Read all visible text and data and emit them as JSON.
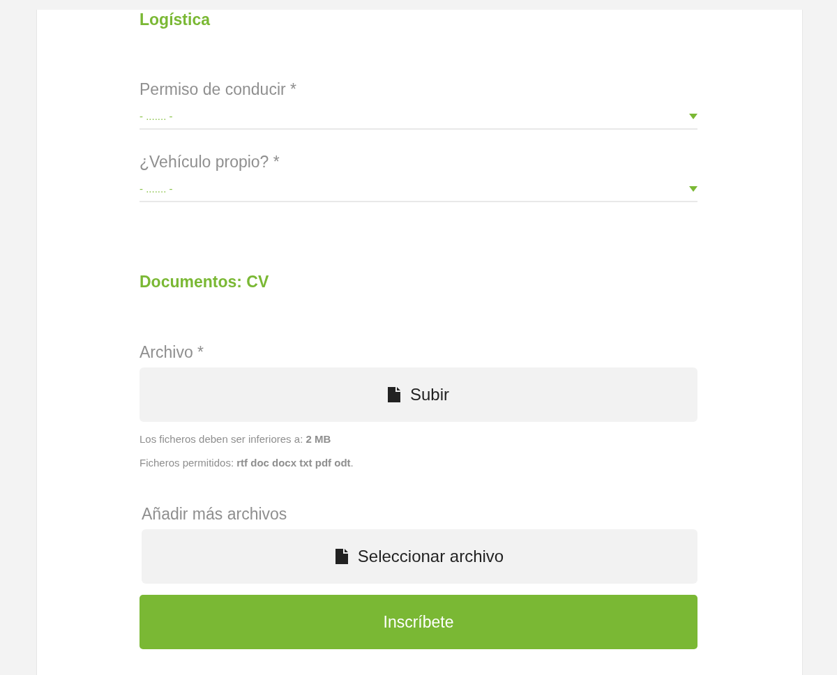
{
  "sections": [
    {
      "title": "Logística",
      "fields": [
        {
          "kind": "select",
          "label": "Permiso de conducir *",
          "value": "- ....... -"
        },
        {
          "kind": "select",
          "label": "¿Vehículo propio? *",
          "value": "- ....... -"
        }
      ]
    },
    {
      "title": "Documentos: CV",
      "fields": [
        {
          "kind": "upload",
          "label": "Archivo *",
          "button": "Subir",
          "notes": [
            "Los ficheros deben ser inferiores a: **2 MB**",
            "Ficheros permitidos: **rtf doc docx txt pdf odt**."
          ]
        },
        {
          "kind": "upload",
          "label": "Añadir más archivos",
          "button": "Seleccionar archivo"
        }
      ]
    }
  ],
  "submit": "Inscríbete"
}
